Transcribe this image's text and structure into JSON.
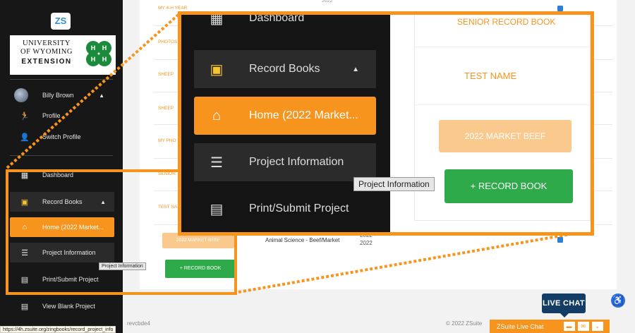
{
  "sidebar": {
    "logo_text": "ZS",
    "university": {
      "line1": "UNIVERSITY",
      "line2": "OF WYOMING",
      "line3": "EXTENSION"
    },
    "user_name": "Billy Brown",
    "items": [
      {
        "label": "Profile",
        "icon": "runner-icon"
      },
      {
        "label": "Switch Profile",
        "icon": "person-icon"
      },
      {
        "label": "Dashboard",
        "icon": "dashboard-icon"
      },
      {
        "label": "Record Books",
        "icon": "record-books-icon"
      },
      {
        "label": "Home (2022 Market...",
        "icon": "home-icon"
      },
      {
        "label": "Project Information",
        "icon": "list-icon"
      },
      {
        "label": "Print/Submit Project",
        "icon": "table-icon"
      },
      {
        "label": "View Blank Project",
        "icon": "table-icon"
      }
    ]
  },
  "main": {
    "row_labels": [
      "MY 4-H YEAR",
      "PHOTOS",
      "SHEEP",
      "SHEEP",
      "MY PHO",
      "SENIOR",
      "TEST NA"
    ],
    "beef_button": "2022 MARKET BEEF",
    "record_book_button": "+ RECORD BOOK",
    "category": "Animal Science - Beef/Market",
    "year_range": [
      "2022 -",
      "2022"
    ],
    "top_year": "2022"
  },
  "tooltip": "Project Information",
  "zoom": {
    "items": [
      "Dashboard",
      "Record Books",
      "Home (2022 Market...",
      "Project Information",
      "Print/Submit Project"
    ],
    "top_label": "SENIOR RECORD BOOK",
    "test_name": "TEST NAME",
    "beef_button": "2022 MARKET BEEF",
    "record_book_button": "+ RECORD BOOK",
    "tooltip": "Project Information"
  },
  "footer": {
    "hash": "revcbde4",
    "copyright": "© 2022 ZSuite",
    "live_chat_bar": "ZSuite Live Chat",
    "live_chat_bubble": "LIVE CHAT",
    "url": "https://4h.zsuite.org/zingbooks/record_project_info"
  },
  "colors": {
    "accent": "#f7941d",
    "green": "#2eaa4a",
    "sidebar": "#171717",
    "navy": "#143d66"
  }
}
